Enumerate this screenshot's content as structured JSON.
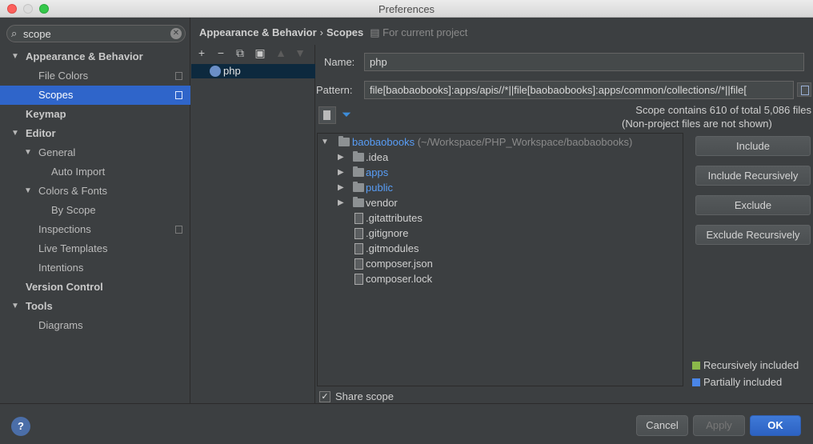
{
  "window": {
    "title": "Preferences"
  },
  "search": {
    "value": "scope"
  },
  "sidebar": {
    "items": [
      {
        "label": "Appearance & Behavior",
        "level": 0,
        "bold": true,
        "arrow": "down"
      },
      {
        "label": "File Colors",
        "level": 1
      },
      {
        "label": "Scopes",
        "level": 1,
        "selected": true
      },
      {
        "label": "Keymap",
        "level": 0,
        "bold": true
      },
      {
        "label": "Editor",
        "level": 0,
        "bold": true,
        "arrow": "down"
      },
      {
        "label": "General",
        "level": 1,
        "arrow": "down"
      },
      {
        "label": "Auto Import",
        "level": 2
      },
      {
        "label": "Colors & Fonts",
        "level": 1,
        "arrow": "down"
      },
      {
        "label": "By Scope",
        "level": 2
      },
      {
        "label": "Inspections",
        "level": 1
      },
      {
        "label": "Live Templates",
        "level": 1
      },
      {
        "label": "Intentions",
        "level": 1
      },
      {
        "label": "Version Control",
        "level": 0,
        "bold": true
      },
      {
        "label": "Tools",
        "level": 0,
        "bold": true,
        "arrow": "down"
      },
      {
        "label": "Diagrams",
        "level": 1
      }
    ]
  },
  "breadcrumb": {
    "section": "Appearance & Behavior",
    "separator": "›",
    "page": "Scopes",
    "note": "For current project"
  },
  "scopes_list": {
    "items": [
      {
        "label": "php"
      }
    ]
  },
  "detail": {
    "name_label": "Name:",
    "name_value": "php",
    "pattern_label": "Pattern:",
    "pattern_value": "file[baobaobooks]:apps/apis//*||file[baobaobooks]:apps/common/collections//*||file[",
    "info_line1": "Scope contains 610 of total 5,086 files",
    "info_line2": "(Non-project files are not shown)"
  },
  "file_tree": {
    "root": {
      "label": "baobaobooks",
      "path": "(~/Workspace/PHP_Workspace/baobaobooks)"
    },
    "children": [
      {
        "label": ".idea",
        "type": "folder",
        "highlight": false
      },
      {
        "label": "apps",
        "type": "folder",
        "highlight": true
      },
      {
        "label": "public",
        "type": "folder",
        "highlight": true
      },
      {
        "label": "vendor",
        "type": "folder",
        "highlight": false
      },
      {
        "label": ".gitattributes",
        "type": "file"
      },
      {
        "label": ".gitignore",
        "type": "file"
      },
      {
        "label": ".gitmodules",
        "type": "file"
      },
      {
        "label": "composer.json",
        "type": "file"
      },
      {
        "label": "composer.lock",
        "type": "file"
      }
    ]
  },
  "actions": {
    "include": "Include",
    "include_rec": "Include Recursively",
    "exclude": "Exclude",
    "exclude_rec": "Exclude Recursively"
  },
  "legend": {
    "recursive": {
      "label": "Recursively included",
      "color": "#8bb84a"
    },
    "partial": {
      "label": "Partially included",
      "color": "#4a86e8"
    }
  },
  "share_scope": {
    "label": "Share scope",
    "checked": true
  },
  "footer": {
    "help": "?",
    "cancel": "Cancel",
    "apply": "Apply",
    "ok": "OK"
  },
  "colors": {
    "selection": "#2f65ca",
    "link_blue": "#589df6"
  }
}
